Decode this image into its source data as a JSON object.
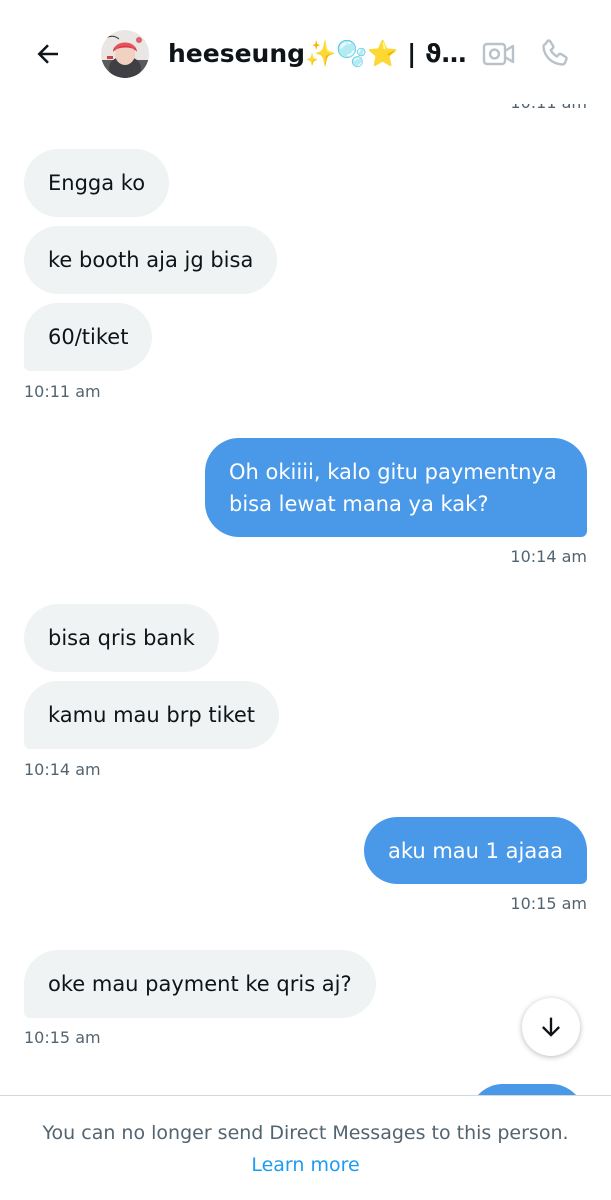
{
  "header": {
    "contact_name": "heeseung✨🫧⭐ | ϑఌ ...",
    "back_icon": "arrow-left-icon",
    "video_icon": "video-camera-icon",
    "call_icon": "phone-icon"
  },
  "messages": [
    {
      "type": "timestamp",
      "side": "right",
      "text": "10:11 am"
    },
    {
      "type": "message",
      "side": "in",
      "text": "Engga ko"
    },
    {
      "type": "message",
      "side": "in",
      "text": "ke booth aja jg bisa"
    },
    {
      "type": "message",
      "side": "in",
      "text": "60/tiket"
    },
    {
      "type": "timestamp",
      "side": "left",
      "text": "10:11 am"
    },
    {
      "type": "message",
      "side": "out",
      "text": "Oh okiiii, kalo gitu paymentnya bisa lewat mana ya kak?"
    },
    {
      "type": "timestamp",
      "side": "right",
      "text": "10:14 am"
    },
    {
      "type": "message",
      "side": "in",
      "text": "bisa qris bank"
    },
    {
      "type": "message",
      "side": "in",
      "text": "kamu mau brp tiket"
    },
    {
      "type": "timestamp",
      "side": "left",
      "text": "10:14 am"
    },
    {
      "type": "message",
      "side": "out",
      "text": "aku mau 1 ajaaa"
    },
    {
      "type": "timestamp",
      "side": "right",
      "text": "10:15 am"
    },
    {
      "type": "message",
      "side": "in",
      "text": "oke mau payment ke qris aj?"
    },
    {
      "type": "timestamp",
      "side": "left",
      "text": "10:15 am"
    }
  ],
  "scroll_button": {
    "icon": "arrow-down-icon"
  },
  "footer": {
    "notice": "You can no longer send Direct Messages to this person.",
    "learn_more": "Learn more"
  },
  "colors": {
    "outgoing_bubble": "#4a99e9",
    "incoming_bubble": "#eff3f4",
    "link": "#1d9bf0",
    "muted_text": "#536471"
  }
}
